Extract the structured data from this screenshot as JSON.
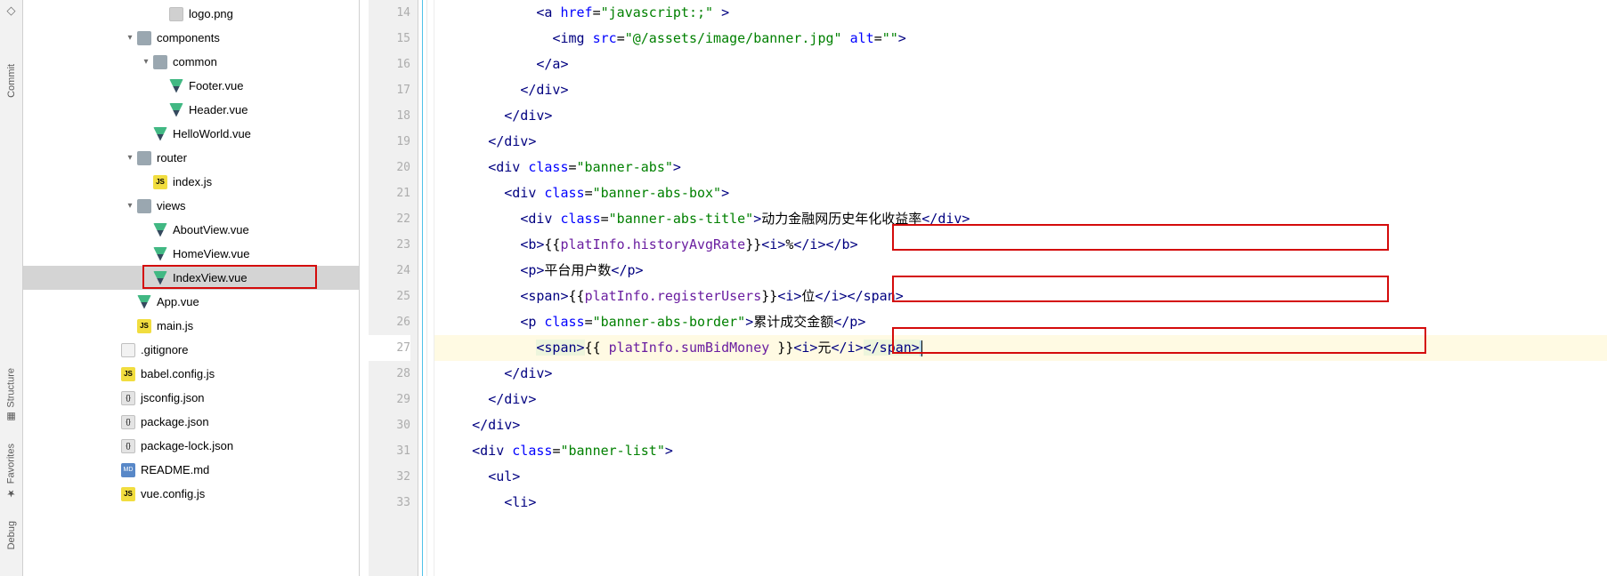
{
  "leftRail": {
    "commit_label": "Commit",
    "structure_label": "Structure",
    "favorites_label": "Favorites",
    "debug_label": "Debug"
  },
  "tree": [
    {
      "depth": 5,
      "chev": "",
      "icon": "png",
      "label": "logo.png",
      "icotext": ""
    },
    {
      "depth": 3,
      "chev": "v",
      "icon": "folder",
      "label": "components",
      "icotext": ""
    },
    {
      "depth": 4,
      "chev": "v",
      "icon": "folder",
      "label": "common",
      "icotext": ""
    },
    {
      "depth": 5,
      "chev": "",
      "icon": "vue",
      "label": "Footer.vue",
      "icotext": ""
    },
    {
      "depth": 5,
      "chev": "",
      "icon": "vue",
      "label": "Header.vue",
      "icotext": ""
    },
    {
      "depth": 4,
      "chev": "",
      "icon": "vue",
      "label": "HelloWorld.vue",
      "icotext": ""
    },
    {
      "depth": 3,
      "chev": "v",
      "icon": "folder",
      "label": "router",
      "icotext": ""
    },
    {
      "depth": 4,
      "chev": "",
      "icon": "js",
      "label": "index.js",
      "icotext": "JS"
    },
    {
      "depth": 3,
      "chev": "v",
      "icon": "folder",
      "label": "views",
      "icotext": ""
    },
    {
      "depth": 4,
      "chev": "",
      "icon": "vue",
      "label": "AboutView.vue",
      "icotext": ""
    },
    {
      "depth": 4,
      "chev": "",
      "icon": "vue",
      "label": "HomeView.vue",
      "icotext": ""
    },
    {
      "depth": 4,
      "chev": "",
      "icon": "vue",
      "label": "IndexView.vue",
      "icotext": "",
      "selected": true
    },
    {
      "depth": 3,
      "chev": "",
      "icon": "vue",
      "label": "App.vue",
      "icotext": ""
    },
    {
      "depth": 3,
      "chev": "",
      "icon": "js",
      "label": "main.js",
      "icotext": "JS"
    },
    {
      "depth": 2,
      "chev": "",
      "icon": "git",
      "label": ".gitignore",
      "icotext": ""
    },
    {
      "depth": 2,
      "chev": "",
      "icon": "js",
      "label": "babel.config.js",
      "icotext": "JS"
    },
    {
      "depth": 2,
      "chev": "",
      "icon": "json",
      "label": "jsconfig.json",
      "icotext": "{}"
    },
    {
      "depth": 2,
      "chev": "",
      "icon": "json",
      "label": "package.json",
      "icotext": "{}"
    },
    {
      "depth": 2,
      "chev": "",
      "icon": "json",
      "label": "package-lock.json",
      "icotext": "{}"
    },
    {
      "depth": 2,
      "chev": "",
      "icon": "md",
      "label": "README.md",
      "icotext": "MD"
    },
    {
      "depth": 2,
      "chev": "",
      "icon": "js",
      "label": "vue.config.js",
      "icotext": "JS"
    }
  ],
  "lineStart": 14,
  "currentLine": 27,
  "code": [
    [
      [
        "",
        12
      ],
      [
        "tag",
        "<a"
      ],
      [
        "text",
        " "
      ],
      [
        "attr",
        "href"
      ],
      [
        "text",
        "="
      ],
      [
        "str",
        "\"javascript:;\""
      ],
      [
        "tag",
        " >"
      ]
    ],
    [
      [
        "",
        14
      ],
      [
        "tag",
        "<img"
      ],
      [
        "text",
        " "
      ],
      [
        "attr",
        "src"
      ],
      [
        "text",
        "="
      ],
      [
        "str",
        "\"@/assets/image/banner.jpg\""
      ],
      [
        "text",
        " "
      ],
      [
        "attr",
        "alt"
      ],
      [
        "text",
        "="
      ],
      [
        "str",
        "\"\""
      ],
      [
        "tag",
        ">"
      ]
    ],
    [
      [
        "",
        12
      ],
      [
        "tag",
        "</a>"
      ]
    ],
    [
      [
        "",
        10
      ],
      [
        "tag",
        "</div>"
      ]
    ],
    [
      [
        "",
        8
      ],
      [
        "tag",
        "</div>"
      ]
    ],
    [
      [
        "",
        6
      ],
      [
        "tag",
        "</div>"
      ]
    ],
    [
      [
        "",
        6
      ],
      [
        "tag",
        "<div"
      ],
      [
        "text",
        " "
      ],
      [
        "attr",
        "class"
      ],
      [
        "text",
        "="
      ],
      [
        "str",
        "\"banner-abs\""
      ],
      [
        "tag",
        ">"
      ]
    ],
    [
      [
        "",
        8
      ],
      [
        "tag",
        "<div"
      ],
      [
        "text",
        " "
      ],
      [
        "attr",
        "class"
      ],
      [
        "text",
        "="
      ],
      [
        "str",
        "\"banner-abs-box\""
      ],
      [
        "tag",
        ">"
      ]
    ],
    [
      [
        "",
        10
      ],
      [
        "tag",
        "<div"
      ],
      [
        "text",
        " "
      ],
      [
        "attr",
        "class"
      ],
      [
        "text",
        "="
      ],
      [
        "str",
        "\"banner-abs-title\""
      ],
      [
        "tag",
        ">"
      ],
      [
        "text",
        "动力金融网历史年化收益率"
      ],
      [
        "tag",
        "</div>"
      ]
    ],
    [
      [
        "",
        10
      ],
      [
        "tag",
        "<b>"
      ],
      [
        "text",
        "{{"
      ],
      [
        "mustache",
        "platInfo.historyAvgRate"
      ],
      [
        "text",
        "}}"
      ],
      [
        "tag",
        "<i>"
      ],
      [
        "text",
        "%"
      ],
      [
        "tag",
        "</i></b>"
      ]
    ],
    [
      [
        "",
        10
      ],
      [
        "tag",
        "<p>"
      ],
      [
        "text",
        "平台用户数"
      ],
      [
        "tag",
        "</p>"
      ]
    ],
    [
      [
        "",
        10
      ],
      [
        "tag",
        "<span>"
      ],
      [
        "text",
        "{{"
      ],
      [
        "mustache",
        "platInfo.registerUsers"
      ],
      [
        "text",
        "}}"
      ],
      [
        "tag",
        "<i>"
      ],
      [
        "text",
        "位"
      ],
      [
        "tag",
        "</i></span>"
      ]
    ],
    [
      [
        "",
        10
      ],
      [
        "tag",
        "<p"
      ],
      [
        "text",
        " "
      ],
      [
        "attr",
        "class"
      ],
      [
        "text",
        "="
      ],
      [
        "str",
        "\"banner-abs-border\""
      ],
      [
        "tag",
        ">"
      ],
      [
        "text",
        "累计成交金额"
      ],
      [
        "tag",
        "</p>"
      ]
    ],
    [
      [
        "",
        12
      ],
      [
        "taghl",
        "<span>"
      ],
      [
        "text",
        "{{ "
      ],
      [
        "mustache",
        "platInfo.sumBidMoney"
      ],
      [
        "text",
        " }}"
      ],
      [
        "tag",
        "<i>"
      ],
      [
        "text",
        "元"
      ],
      [
        "tag",
        "</i>"
      ],
      [
        "taghl",
        "</span>"
      ],
      [
        "selend",
        ""
      ],
      [
        "caret",
        ""
      ]
    ],
    [
      [
        "",
        8
      ],
      [
        "tag",
        "</div>"
      ]
    ],
    [
      [
        "",
        6
      ],
      [
        "tag",
        "</div>"
      ]
    ],
    [
      [
        "",
        4
      ],
      [
        "tag",
        "</div>"
      ]
    ],
    [
      [
        "",
        4
      ],
      [
        "tag",
        "<div"
      ],
      [
        "text",
        " "
      ],
      [
        "attr",
        "class"
      ],
      [
        "text",
        "="
      ],
      [
        "str",
        "\"banner-list\""
      ],
      [
        "tag",
        ">"
      ]
    ],
    [
      [
        "",
        6
      ],
      [
        "tag",
        "<ul>"
      ]
    ],
    [
      [
        "",
        8
      ],
      [
        "tag",
        "<li>"
      ]
    ]
  ]
}
